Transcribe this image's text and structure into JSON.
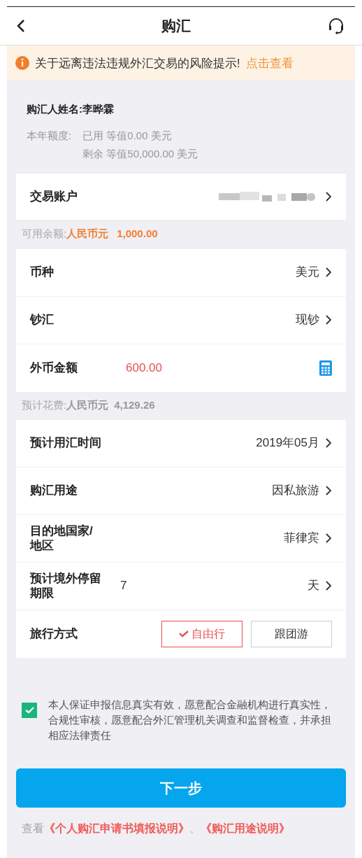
{
  "header": {
    "title": "购汇"
  },
  "notice": {
    "text": "关于远离违法违规外汇交易的风险提示!",
    "link": "点击查看"
  },
  "buyer": {
    "label": "购汇人姓名:",
    "name": "李晔霖"
  },
  "quota": {
    "label": "本年额度:",
    "lines": [
      "已用 等值0.00 美元",
      "剩余 等值50,000.00 美元"
    ]
  },
  "account": {
    "label": "交易账户"
  },
  "balance": {
    "label": "可用余额:",
    "currency": "人民币元",
    "amount": "1,000.00"
  },
  "currency_rows": [
    {
      "kind": "select",
      "label": "币种",
      "value": "美元"
    },
    {
      "kind": "select",
      "label": "钞汇",
      "value": "现钞"
    },
    {
      "kind": "amount",
      "label": "外币金额",
      "value": "600.00"
    }
  ],
  "cost": {
    "label": "预计花费:",
    "currency": "人民币元",
    "amount": "4,129.26"
  },
  "detail_rows": [
    {
      "kind": "select",
      "label": "预计用汇时间",
      "value": "2019年05月"
    },
    {
      "kind": "select",
      "label": "购汇用途",
      "value": "因私旅游"
    },
    {
      "kind": "select",
      "label": "目的地国家/地区",
      "value": "菲律宾"
    },
    {
      "kind": "duration",
      "label": "预计境外停留期限",
      "value": "7",
      "unit": "天"
    },
    {
      "kind": "options",
      "label": "旅行方式",
      "options": [
        {
          "label": "自由行",
          "selected": true
        },
        {
          "label": "跟团游",
          "selected": false
        }
      ]
    }
  ],
  "agreement": {
    "checked": true,
    "text": "本人保证申报信息真实有效，愿意配合金融机构进行真实性，合规性审核，愿意配合外汇管理机关调查和监督检查，并承担相应法律责任"
  },
  "next_button": "下一步",
  "footer": {
    "prefix": "查看",
    "links": [
      "《个人购汇申请书填报说明》",
      "《购汇用途说明》"
    ],
    "separator": "、"
  }
}
